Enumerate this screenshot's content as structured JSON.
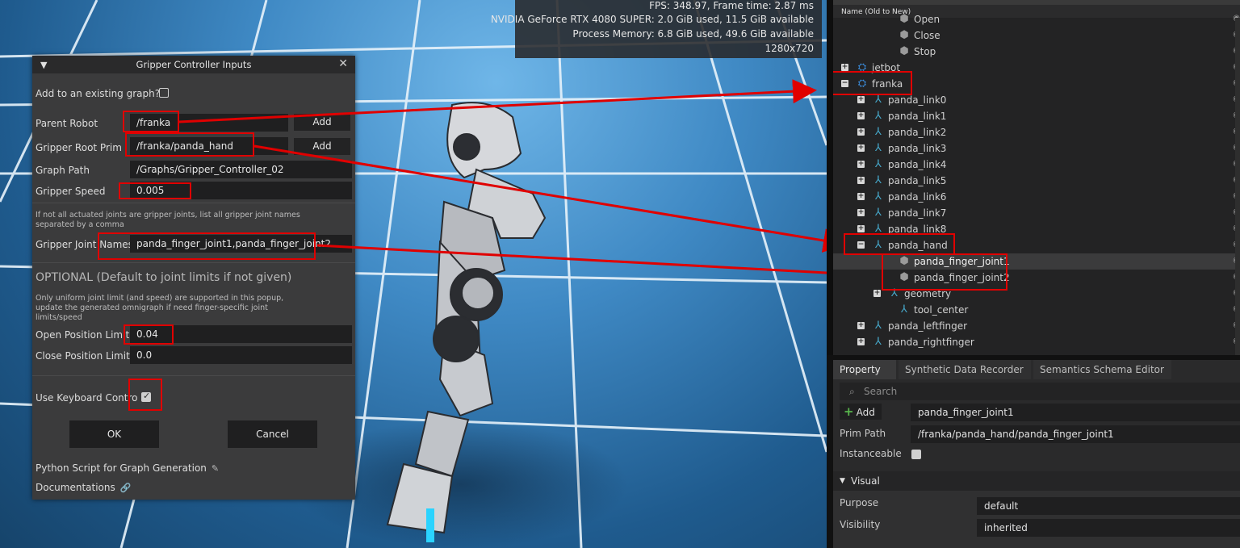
{
  "stats": {
    "fps": "FPS: 348.97, Frame time: 2.87 ms",
    "gpu": "NVIDIA GeForce RTX 4080 SUPER: 2.0 GiB used, 11.5 GiB available",
    "process_memory": "Process Memory: 6.8 GiB used, 49.6 GiB available",
    "resolution": "1280x720"
  },
  "dialog": {
    "title": "Gripper Controller Inputs",
    "add_existing_label": "Add to an existing graph?",
    "add_existing_checked": false,
    "parent_robot_label": "Parent Robot",
    "parent_robot_value": "/franka",
    "gripper_root_label": "Gripper Root Prim",
    "gripper_root_value": "/franka/panda_hand",
    "add_label": "Add",
    "graph_path_label": "Graph Path",
    "graph_path_value": "/Graphs/Gripper_Controller_02",
    "gripper_speed_label": "Gripper Speed",
    "gripper_speed_value": "0.005",
    "joint_note_line1": "If not all actuated joints are gripper joints, list all gripper joint names",
    "joint_note_line2": "separated by a comma",
    "joint_names_label": "Gripper Joint Names",
    "joint_names_value": "panda_finger_joint1,panda_finger_joint2",
    "optional_heading": "OPTIONAL (Default to joint limits if not given)",
    "optional_note_line1": "Only uniform joint limit (and speed) are supported in this popup,",
    "optional_note_line2": "update the generated omnigraph if need finger-specific joint",
    "optional_note_line3": "limits/speed",
    "open_limit_label": "Open Position Limit",
    "open_limit_value": "0.04",
    "close_limit_label": "Close Position Limit",
    "close_limit_value": "0.0",
    "keyboard_label": "Use Keyboard Contro",
    "keyboard_checked": true,
    "ok_label": "OK",
    "cancel_label": "Cancel",
    "python_script_label": "Python Script for Graph Generation",
    "documentation_label": "Documentations"
  },
  "stage": {
    "header": "Name (Old to New)",
    "rows": [
      {
        "label": "Open",
        "icon": "cube-icon"
      },
      {
        "label": "Close",
        "icon": "cube-icon"
      },
      {
        "label": "Stop",
        "icon": "cube-icon"
      },
      {
        "label": "jetbot",
        "icon": "robot-icon",
        "expander": "+"
      },
      {
        "label": "franka",
        "icon": "robot-icon",
        "expander": "−"
      },
      {
        "label": "panda_link0",
        "icon": "xform-icon",
        "expander": "+"
      },
      {
        "label": "panda_link1",
        "icon": "xform-icon",
        "expander": "+"
      },
      {
        "label": "panda_link2",
        "icon": "xform-icon",
        "expander": "+"
      },
      {
        "label": "panda_link3",
        "icon": "xform-icon",
        "expander": "+"
      },
      {
        "label": "panda_link4",
        "icon": "xform-icon",
        "expander": "+"
      },
      {
        "label": "panda_link5",
        "icon": "xform-icon",
        "expander": "+"
      },
      {
        "label": "panda_link6",
        "icon": "xform-icon",
        "expander": "+"
      },
      {
        "label": "panda_link7",
        "icon": "xform-icon",
        "expander": "+"
      },
      {
        "label": "panda_link8",
        "icon": "xform-icon",
        "expander": "+"
      },
      {
        "label": "panda_hand",
        "icon": "xform-icon",
        "expander": "−"
      },
      {
        "label": "panda_finger_joint1",
        "icon": "cube-icon",
        "selected": true
      },
      {
        "label": "panda_finger_joint2",
        "icon": "cube-icon"
      },
      {
        "label": "geometry",
        "icon": "xform-icon",
        "expander": "+"
      },
      {
        "label": "tool_center",
        "icon": "xform-icon"
      },
      {
        "label": "panda_leftfinger",
        "icon": "xform-icon",
        "expander": "+"
      },
      {
        "label": "panda_rightfinger",
        "icon": "xform-icon",
        "expander": "+"
      }
    ]
  },
  "property": {
    "tabs": [
      "Property",
      "Synthetic Data Recorder",
      "Semantics Schema Editor"
    ],
    "search_placeholder": "Search",
    "add_label": "Add",
    "prim_name": "panda_finger_joint1",
    "prim_path_label": "Prim Path",
    "prim_path_value": "/franka/panda_hand/panda_finger_joint1",
    "instanceable_label": "Instanceable",
    "visual_section": "Visual",
    "purpose_label": "Purpose",
    "purpose_value": "default",
    "visibility_label": "Visibility",
    "visibility_value": "inherited"
  }
}
